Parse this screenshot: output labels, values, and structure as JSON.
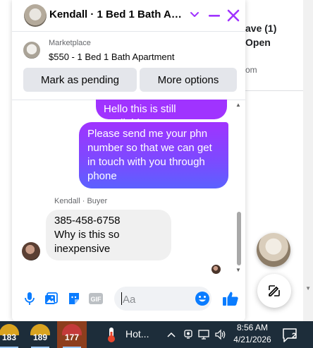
{
  "background_page": {
    "line1": "ave (1)",
    "line2": "Open",
    "line3": "om"
  },
  "chat": {
    "header": {
      "title": "Kendall · 1 Bed 1 Bath Apartment"
    },
    "listing": {
      "label": "Marketplace",
      "title": "$550 - 1 Bed 1 Bath Apartment"
    },
    "actions": {
      "mark_pending": "Mark as pending",
      "more_options": "More options"
    },
    "messages": {
      "outgoing_1": "Hello this is still available",
      "outgoing_2": "Please send me your phn number so that we can get in touch with you through phone",
      "incoming_sender": "Kendall · Buyer",
      "incoming_line1": "385-458-6758",
      "incoming_line2": "Why is this so inexpensive"
    },
    "composer": {
      "placeholder": "Aa",
      "gif_label": "GIF"
    },
    "colors": {
      "accent": "#a033ff",
      "accent_end": "#5b61ff",
      "like_blue": "#0a7cff"
    }
  },
  "taskbar": {
    "apps": [
      {
        "badge": "183"
      },
      {
        "badge": "189"
      },
      {
        "badge": "177"
      }
    ],
    "weather_label": "Hot...",
    "time": "8:56 AM",
    "date": "4/21/2026",
    "notification_count": "2"
  }
}
